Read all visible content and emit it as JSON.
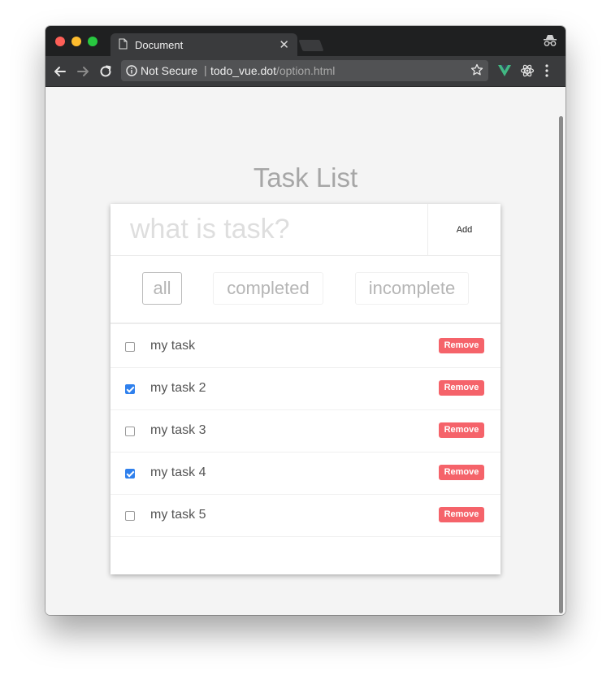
{
  "browser": {
    "tab": {
      "title": "Document"
    },
    "address": {
      "security_label": "Not Secure",
      "separator": "|",
      "host": "todo_vue.dot",
      "path": "/option.html"
    },
    "icons": [
      "file-icon",
      "close-icon",
      "incognito-icon",
      "back-icon",
      "forward-icon",
      "reload-icon",
      "info-icon",
      "star-icon",
      "vue-devtools-icon",
      "react-devtools-icon",
      "menu-icon"
    ]
  },
  "page": {
    "title": "Task List",
    "input": {
      "placeholder": "what is task?",
      "value": ""
    },
    "add_label": "Add",
    "filters": [
      {
        "label": "all",
        "active": true
      },
      {
        "label": "completed",
        "active": false
      },
      {
        "label": "incomplete",
        "active": false
      }
    ],
    "tasks": [
      {
        "label": "my task",
        "done": false,
        "remove_label": "Remove"
      },
      {
        "label": "my task 2",
        "done": true,
        "remove_label": "Remove"
      },
      {
        "label": "my task 3",
        "done": false,
        "remove_label": "Remove"
      },
      {
        "label": "my task 4",
        "done": true,
        "remove_label": "Remove"
      },
      {
        "label": "my task 5",
        "done": false,
        "remove_label": "Remove"
      }
    ]
  },
  "colors": {
    "remove_button": "#f5636a",
    "checkbox_checked": "#2f80ed",
    "vue_green": "#41b883"
  }
}
